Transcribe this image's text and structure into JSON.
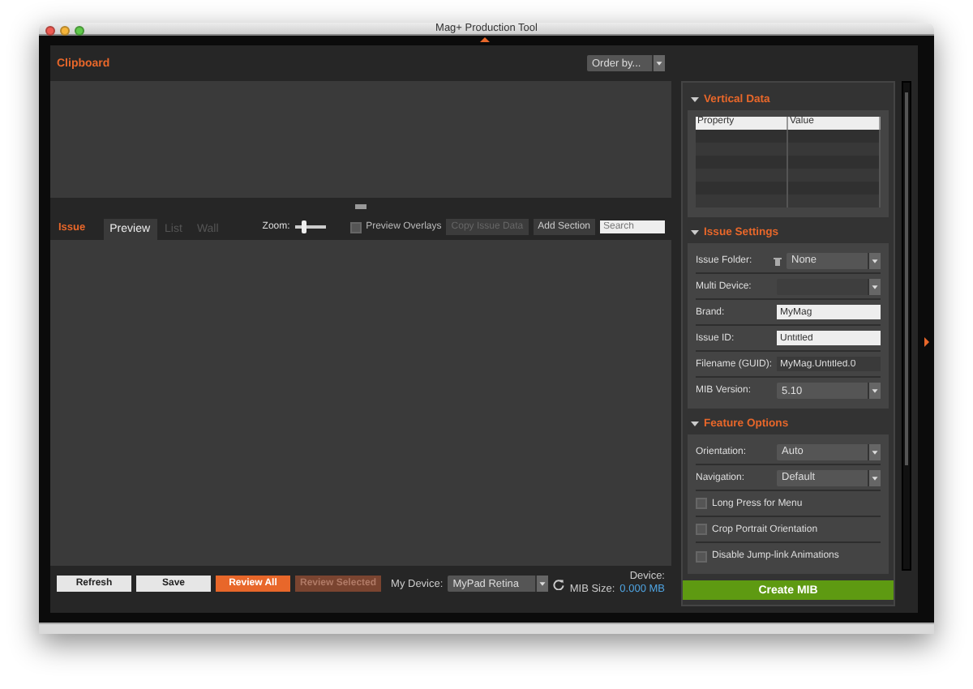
{
  "window": {
    "title": "Mag+ Production Tool"
  },
  "clipboard": {
    "title": "Clipboard",
    "order_by": {
      "value": "Order by..."
    }
  },
  "issue": {
    "title": "Issue",
    "tabs": [
      {
        "label": "Preview",
        "selected": true,
        "disabled": false
      },
      {
        "label": "List",
        "selected": false,
        "disabled": true
      },
      {
        "label": "Wall",
        "selected": false,
        "disabled": true
      }
    ],
    "zoom": {
      "label": "Zoom:",
      "level": 0.3
    },
    "preview_overlays": {
      "label": "Preview Overlays",
      "checked": false
    },
    "buttons": [
      {
        "label": "Copy Issue Data",
        "disabled": true
      },
      {
        "label": "Add Section",
        "disabled": false
      }
    ],
    "search": {
      "placeholder": "Search"
    }
  },
  "bottom_bar": {
    "buttons": [
      {
        "label": "Refresh",
        "kind": "light",
        "disabled": false
      },
      {
        "label": "Save",
        "kind": "light",
        "disabled": false
      },
      {
        "label": "Review All",
        "kind": "accent",
        "disabled": false
      },
      {
        "label": "Review Selected",
        "kind": "accent",
        "disabled": true
      }
    ],
    "device": {
      "label": "My Device:",
      "value": "MyPad Retina"
    },
    "device_label": "Device:",
    "mib_size": {
      "label": "MIB Size:",
      "value": "0.000 MB"
    }
  },
  "sidebar": {
    "sections": [
      {
        "title": "Vertical Data",
        "expanded": true,
        "kind": "table",
        "columns": [
          "Property",
          "Value"
        ]
      },
      {
        "title": "Issue Settings",
        "expanded": true,
        "kind": "form",
        "fields": [
          {
            "label": "Issue Folder:",
            "kind": "folder",
            "value": "None",
            "disabled": false
          },
          {
            "label": "Multi Device:",
            "kind": "select",
            "disabled": true
          },
          {
            "label": "Brand:",
            "kind": "text",
            "value": "MyMag",
            "disabled": false
          },
          {
            "label": "Issue ID:",
            "kind": "text",
            "value": "Untitled",
            "disabled": false
          },
          {
            "label": "Filename (GUID):",
            "kind": "readonly",
            "value": "MyMag.Untitled.0",
            "disabled": false
          },
          {
            "label": "MIB Version:",
            "kind": "select",
            "value": "5.10",
            "disabled": false
          }
        ]
      },
      {
        "title": "Feature Options",
        "expanded": true,
        "kind": "form",
        "fields": [
          {
            "label": "Orientation:",
            "kind": "select",
            "value": "Auto",
            "disabled": false
          },
          {
            "label": "Navigation:",
            "kind": "select",
            "value": "Default",
            "disabled": false
          },
          {
            "label": "Long Press for Menu",
            "kind": "checkbox",
            "checked": false
          },
          {
            "label": "Crop Portrait Orientation",
            "kind": "checkbox",
            "checked": false
          },
          {
            "label": "Disable Jump-link Animations",
            "kind": "checkbox",
            "checked": false
          }
        ]
      }
    ]
  },
  "create_button": {
    "label": "Create MIB"
  }
}
